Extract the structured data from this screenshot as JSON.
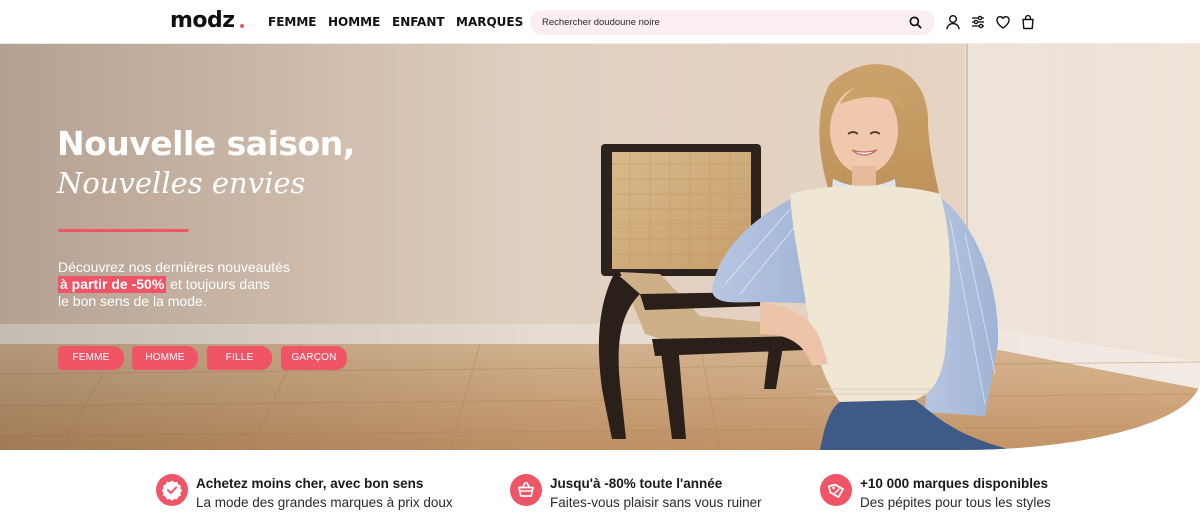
{
  "brand": {
    "logo": "modz",
    "accent_color": "#ef5567"
  },
  "nav": [
    {
      "label": "FEMME"
    },
    {
      "label": "HOMME"
    },
    {
      "label": "ENFANT"
    },
    {
      "label": "MARQUES"
    }
  ],
  "search": {
    "text": "Rechercher doudoune noire",
    "icon": "search-icon"
  },
  "header_icons": [
    "user-icon",
    "filters-icon",
    "heart-icon",
    "bag-icon"
  ],
  "hero": {
    "title": "Nouvelle saison,",
    "subtitle": "Nouvelles envies",
    "desc_line1": "Découvrez nos dernières nouveautés",
    "desc_highlight": "à partir de -50%",
    "desc_line2_rest": "et toujours dans",
    "desc_line3": "le bon sens de la mode.",
    "categories": [
      {
        "label": "FEMME"
      },
      {
        "label": "HOMME"
      },
      {
        "label": "FILLE"
      },
      {
        "label": "GARÇON"
      }
    ]
  },
  "features": [
    {
      "icon": "check-badge-icon",
      "title": "Achetez moins cher, avec bon sens",
      "text": "La mode des grandes marques à prix doux"
    },
    {
      "icon": "basket-icon",
      "title": "Jusqu'à -80% toute l'année",
      "text": "Faites-vous plaisir sans vous ruiner"
    },
    {
      "icon": "price-tag-icon",
      "title": "+10 000 marques disponibles",
      "text": "Des pépites pour tous les styles"
    }
  ]
}
